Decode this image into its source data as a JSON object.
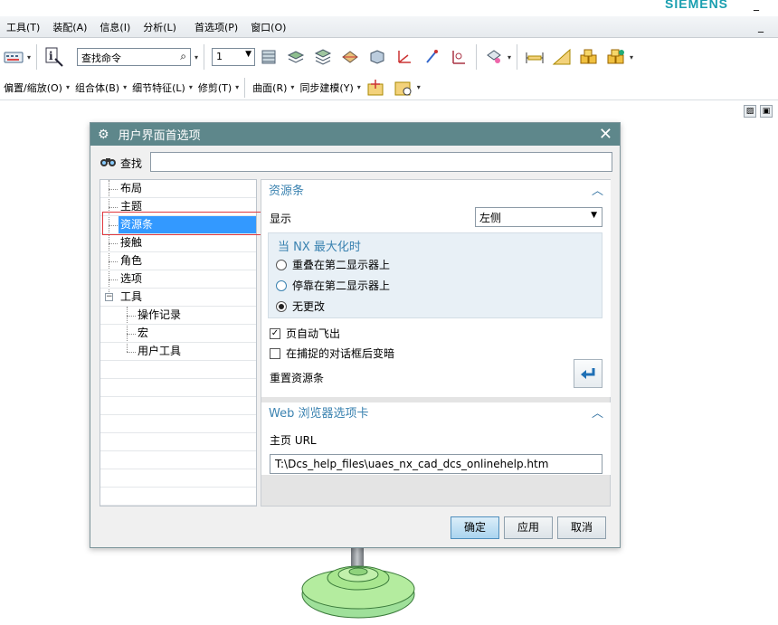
{
  "app": {
    "brand": "SIEMENS",
    "window_min": "_",
    "menu": [
      "工具(T)",
      "装配(A)",
      "信息(I)",
      "分析(L)",
      "首选项(P)",
      "窗口(O)"
    ],
    "menu_right": "_"
  },
  "toolbar1": {
    "search_placeholder": "查找命令",
    "number_value": "1"
  },
  "toolbar2": {
    "items": [
      "偏置/缩放(O)",
      "组合体(B)",
      "细节特征(L)",
      "修剪(T)",
      "曲面(R)",
      "同步建模(Y)"
    ]
  },
  "dialog": {
    "title": "用户界面首选项",
    "find_label": "查找",
    "find_value": "",
    "tree": [
      {
        "label": "布局",
        "level": 0
      },
      {
        "label": "主题",
        "level": 0
      },
      {
        "label": "资源条",
        "level": 0,
        "selected": true
      },
      {
        "label": "接触",
        "level": 0
      },
      {
        "label": "角色",
        "level": 0
      },
      {
        "label": "选项",
        "level": 0
      },
      {
        "label": "工具",
        "level": 0,
        "expander": "−"
      },
      {
        "label": "操作记录",
        "level": 1
      },
      {
        "label": "宏",
        "level": 1
      },
      {
        "label": "用户工具",
        "level": 1
      }
    ],
    "resource_bar": {
      "title": "资源条",
      "display_label": "显示",
      "display_value": "左侧",
      "maximized_title": "当 NX 最大化时",
      "radios": [
        {
          "label": "重叠在第二显示器上",
          "checked": false
        },
        {
          "label": "停靠在第二显示器上",
          "checked": false
        },
        {
          "label": "无更改",
          "checked": true
        }
      ],
      "checkboxes": [
        {
          "label": "页自动飞出",
          "checked": true
        },
        {
          "label": "在捕捉的对话框后变暗",
          "checked": false
        }
      ],
      "reset_label": "重置资源条"
    },
    "web_tab": {
      "title": "Web 浏览器选项卡",
      "home_url_label": "主页 URL",
      "home_url_value": "T:\\Dcs_help_files\\uaes_nx_cad_dcs_onlinehelp.htm"
    },
    "buttons": {
      "ok": "确定",
      "apply": "应用",
      "cancel": "取消"
    }
  }
}
